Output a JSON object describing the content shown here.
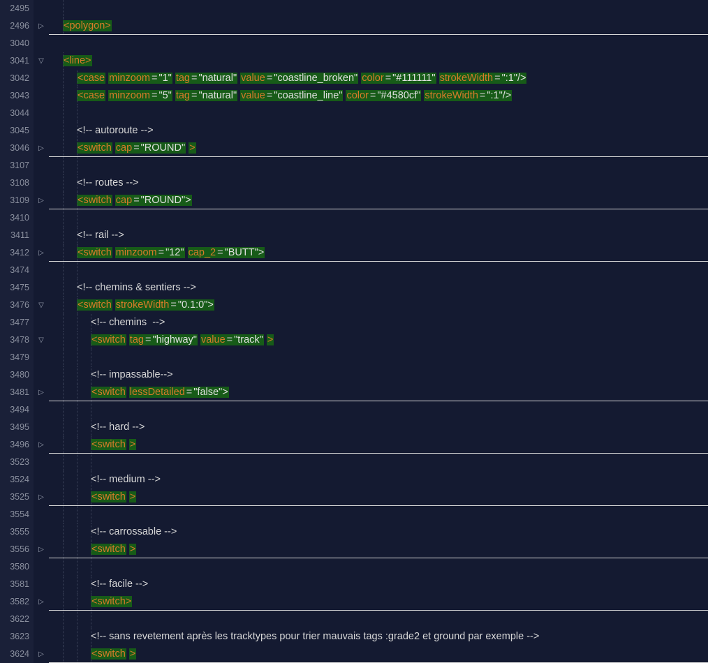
{
  "lineNumbers": [
    "2495",
    "2496",
    "3040",
    "3041",
    "3042",
    "3043",
    "3044",
    "3045",
    "3046",
    "3107",
    "3108",
    "3109",
    "3410",
    "3411",
    "3412",
    "3474",
    "3475",
    "3476",
    "3477",
    "3478",
    "3479",
    "3480",
    "3481",
    "3494",
    "3495",
    "3496",
    "3523",
    "3524",
    "3525",
    "3554",
    "3555",
    "3556",
    "3580",
    "3581",
    "3582",
    "3622",
    "3623",
    "3624"
  ],
  "folding": [
    "",
    "right",
    "",
    "down",
    "",
    "",
    "",
    "",
    "right",
    "",
    "",
    "right",
    "",
    "",
    "right",
    "",
    "",
    "down",
    "",
    "down",
    "",
    "",
    "right",
    "",
    "",
    "right",
    "",
    "",
    "right",
    "",
    "",
    "right",
    "",
    "",
    "right",
    "",
    "",
    "right"
  ],
  "separators": [
    false,
    true,
    false,
    false,
    false,
    false,
    false,
    false,
    true,
    false,
    false,
    true,
    false,
    false,
    true,
    false,
    false,
    false,
    false,
    false,
    false,
    false,
    true,
    false,
    false,
    true,
    false,
    false,
    true,
    false,
    false,
    true,
    false,
    false,
    true,
    false,
    false,
    true
  ],
  "indents": [
    1,
    1,
    0,
    1,
    2,
    2,
    2,
    2,
    2,
    2,
    2,
    2,
    2,
    2,
    2,
    2,
    2,
    2,
    3,
    3,
    3,
    3,
    3,
    3,
    3,
    3,
    3,
    3,
    3,
    3,
    3,
    3,
    3,
    3,
    3,
    3,
    3,
    3
  ],
  "lines": {
    "l0": {
      "type": "blank"
    },
    "l1": {
      "type": "tag",
      "tokens": [
        {
          "k": "tag",
          "t": "<polygon>"
        }
      ]
    },
    "l2": {
      "type": "blank"
    },
    "l3": {
      "type": "tag",
      "tokens": [
        {
          "k": "tag",
          "t": "<line>"
        }
      ]
    },
    "l4": {
      "type": "tag",
      "tokens": [
        {
          "k": "tag",
          "t": "<case"
        },
        {
          "k": "sp"
        },
        {
          "k": "attr",
          "t": "minzoom"
        },
        {
          "k": "punc",
          "t": "="
        },
        {
          "k": "val",
          "t": "\"1\""
        },
        {
          "k": "sp"
        },
        {
          "k": "attr",
          "t": "tag"
        },
        {
          "k": "punc",
          "t": "="
        },
        {
          "k": "val",
          "t": "\"natural\""
        },
        {
          "k": "sp"
        },
        {
          "k": "attr",
          "t": "value"
        },
        {
          "k": "punc",
          "t": "="
        },
        {
          "k": "val",
          "t": "\"coastline_broken\""
        },
        {
          "k": "sp"
        },
        {
          "k": "attr",
          "t": "color"
        },
        {
          "k": "punc",
          "t": "="
        },
        {
          "k": "val",
          "t": "\"#111111\""
        },
        {
          "k": "sp"
        },
        {
          "k": "attr",
          "t": "strokeWidth"
        },
        {
          "k": "punc",
          "t": "="
        },
        {
          "k": "val",
          "t": "\":1\"/>"
        }
      ]
    },
    "l5": {
      "type": "tag",
      "tokens": [
        {
          "k": "tag",
          "t": "<case"
        },
        {
          "k": "sp"
        },
        {
          "k": "attr",
          "t": "minzoom"
        },
        {
          "k": "punc",
          "t": "="
        },
        {
          "k": "val",
          "t": "\"5\""
        },
        {
          "k": "sp"
        },
        {
          "k": "attr",
          "t": "tag"
        },
        {
          "k": "punc",
          "t": "="
        },
        {
          "k": "val",
          "t": "\"natural\""
        },
        {
          "k": "sp"
        },
        {
          "k": "attr",
          "t": "value"
        },
        {
          "k": "punc",
          "t": "="
        },
        {
          "k": "val",
          "t": "\"coastline_line\""
        },
        {
          "k": "sp"
        },
        {
          "k": "attr",
          "t": "color"
        },
        {
          "k": "punc",
          "t": "="
        },
        {
          "k": "val",
          "t": "\"#4580cf\""
        },
        {
          "k": "sp"
        },
        {
          "k": "attr",
          "t": "strokeWidth"
        },
        {
          "k": "punc",
          "t": "="
        },
        {
          "k": "val",
          "t": "\":1\"/>"
        }
      ]
    },
    "l6": {
      "type": "blank"
    },
    "l7": {
      "type": "comment",
      "text": "<!-- autoroute -->"
    },
    "l8": {
      "type": "tag",
      "tokens": [
        {
          "k": "tag",
          "t": "<switch"
        },
        {
          "k": "sp"
        },
        {
          "k": "attr",
          "t": "cap"
        },
        {
          "k": "punc",
          "t": "="
        },
        {
          "k": "val",
          "t": "\"ROUND\""
        },
        {
          "k": "sp"
        },
        {
          "k": "tag",
          "t": ">"
        }
      ]
    },
    "l9": {
      "type": "blank"
    },
    "l10": {
      "type": "comment",
      "text": "<!-- routes -->"
    },
    "l11": {
      "type": "tag",
      "tokens": [
        {
          "k": "tag",
          "t": "<switch"
        },
        {
          "k": "sp"
        },
        {
          "k": "attr",
          "t": "cap"
        },
        {
          "k": "punc",
          "t": "="
        },
        {
          "k": "val",
          "t": "\"ROUND\">"
        }
      ]
    },
    "l12": {
      "type": "blank"
    },
    "l13": {
      "type": "comment",
      "text": "<!-- rail -->"
    },
    "l14": {
      "type": "tag",
      "tokens": [
        {
          "k": "tag",
          "t": "<switch"
        },
        {
          "k": "sp"
        },
        {
          "k": "attr",
          "t": "minzoom"
        },
        {
          "k": "punc",
          "t": "="
        },
        {
          "k": "val",
          "t": "\"12\""
        },
        {
          "k": "sp"
        },
        {
          "k": "attr",
          "t": "cap_2"
        },
        {
          "k": "punc",
          "t": "="
        },
        {
          "k": "val",
          "t": "\"BUTT\">"
        }
      ]
    },
    "l15": {
      "type": "blank"
    },
    "l16": {
      "type": "comment",
      "text": "<!-- chemins & sentiers -->"
    },
    "l17": {
      "type": "tag",
      "tokens": [
        {
          "k": "tag",
          "t": "<switch"
        },
        {
          "k": "sp"
        },
        {
          "k": "attr",
          "t": "strokeWidth"
        },
        {
          "k": "punc",
          "t": "="
        },
        {
          "k": "val",
          "t": "\"0.1:0\">"
        }
      ]
    },
    "l18": {
      "type": "comment",
      "text": "<!-- chemins  -->"
    },
    "l19": {
      "type": "tag",
      "tokens": [
        {
          "k": "tag",
          "t": "<switch"
        },
        {
          "k": "sp"
        },
        {
          "k": "attr",
          "t": "tag"
        },
        {
          "k": "punc",
          "t": "="
        },
        {
          "k": "val",
          "t": "\"highway\""
        },
        {
          "k": "sp"
        },
        {
          "k": "attr",
          "t": "value"
        },
        {
          "k": "punc",
          "t": "="
        },
        {
          "k": "val",
          "t": "\"track\""
        },
        {
          "k": "sp"
        },
        {
          "k": "tag",
          "t": ">"
        }
      ]
    },
    "l20": {
      "type": "blank"
    },
    "l21": {
      "type": "comment",
      "text": "<!-- impassable-->"
    },
    "l22": {
      "type": "tag",
      "tokens": [
        {
          "k": "tag",
          "t": "<switch"
        },
        {
          "k": "sp"
        },
        {
          "k": "attr",
          "t": "lessDetailed"
        },
        {
          "k": "punc",
          "t": "="
        },
        {
          "k": "val",
          "t": "\"false\">"
        }
      ]
    },
    "l23": {
      "type": "blank"
    },
    "l24": {
      "type": "comment",
      "text": "<!-- hard -->"
    },
    "l25": {
      "type": "tag",
      "tokens": [
        {
          "k": "tag",
          "t": "<switch"
        },
        {
          "k": "sp"
        },
        {
          "k": "tag",
          "t": ">"
        }
      ]
    },
    "l26": {
      "type": "blank"
    },
    "l27": {
      "type": "comment",
      "text": "<!-- medium -->"
    },
    "l28": {
      "type": "tag",
      "tokens": [
        {
          "k": "tag",
          "t": "<switch"
        },
        {
          "k": "sp"
        },
        {
          "k": "tag",
          "t": ">"
        }
      ]
    },
    "l29": {
      "type": "blank"
    },
    "l30": {
      "type": "comment",
      "text": "<!-- carrossable -->"
    },
    "l31": {
      "type": "tag",
      "tokens": [
        {
          "k": "tag",
          "t": "<switch"
        },
        {
          "k": "sp"
        },
        {
          "k": "tag",
          "t": ">"
        }
      ]
    },
    "l32": {
      "type": "blank"
    },
    "l33": {
      "type": "comment",
      "text": "<!-- facile -->"
    },
    "l34": {
      "type": "tag",
      "tokens": [
        {
          "k": "tag",
          "t": "<switch>"
        }
      ]
    },
    "l35": {
      "type": "blank"
    },
    "l36": {
      "type": "comment",
      "text": "<!-- sans revetement après les tracktypes pour trier mauvais tags :grade2 et ground par exemple -->"
    },
    "l37": {
      "type": "tag",
      "tokens": [
        {
          "k": "tag",
          "t": "<switch"
        },
        {
          "k": "sp"
        },
        {
          "k": "tag",
          "t": ">"
        }
      ]
    }
  }
}
